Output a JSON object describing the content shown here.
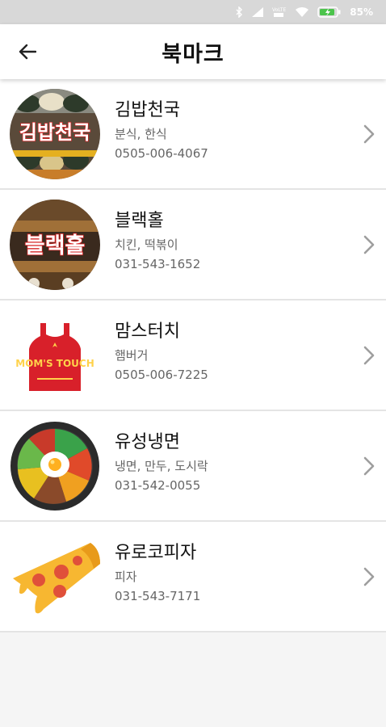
{
  "status_bar": {
    "icons": [
      "bluetooth-icon",
      "cell-signal-icon",
      "volte-icon",
      "wifi-icon",
      "battery-charging-icon"
    ],
    "volte_label": "VoLTE",
    "battery_percent": "85%"
  },
  "app_bar": {
    "back_icon": "arrow-left-icon",
    "title": "북마크"
  },
  "bookmarks": [
    {
      "name": "김밥천국",
      "category": "분식, 한식",
      "phone": "0505-006-4067",
      "logo_text": "김밥천국"
    },
    {
      "name": "블랙홀",
      "category": "치킨, 떡볶이",
      "phone": "031-543-1652",
      "logo_text": "블랙홀"
    },
    {
      "name": "맘스터치",
      "category": "햄버거",
      "phone": "0505-006-7225",
      "logo_text": "MOM'S TOUCH"
    },
    {
      "name": "유성냉면",
      "category": "냉면, 만두, 도시락",
      "phone": "031-542-0055"
    },
    {
      "name": "유로코피자",
      "category": "피자",
      "phone": "031-543-7171"
    }
  ],
  "colors": {
    "status_bar_bg": "#d8d8d8",
    "app_bar_bg": "#ffffff",
    "chevron": "#9e9e9e",
    "divider": "#e4e4e4",
    "page_bg": "#f5f5f5"
  }
}
